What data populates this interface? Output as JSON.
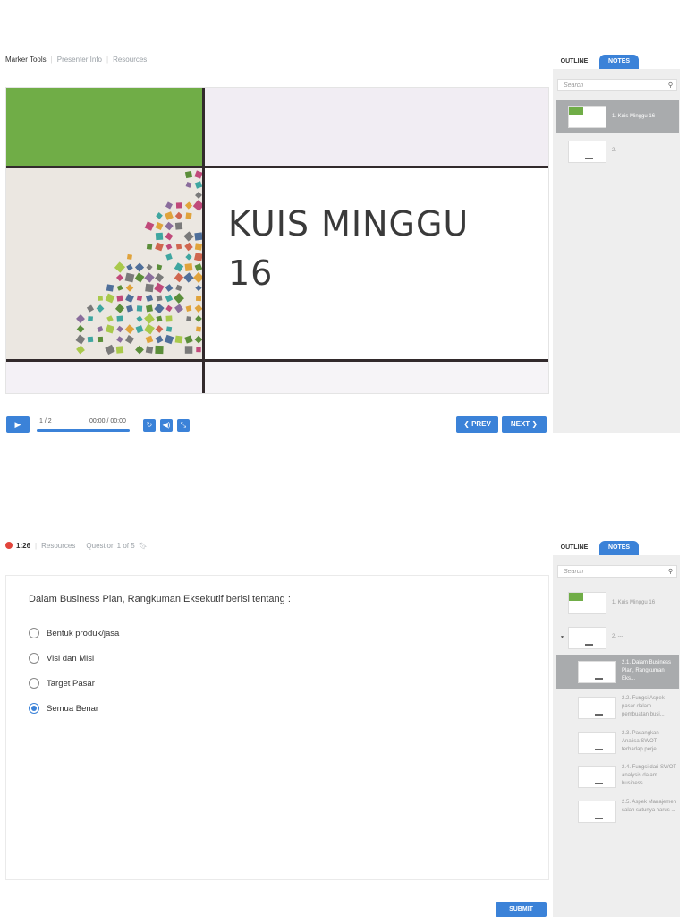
{
  "panel1": {
    "topbar": [
      "Marker Tools",
      "Presenter Info",
      "Resources"
    ],
    "slide_title_line1": "KUIS MINGGU",
    "slide_title_line2": "16",
    "controls": {
      "play_icon": "play-icon",
      "slide_counter": "1 / 2",
      "time": "00:00 / 00:00",
      "progress": 1.0,
      "icons": [
        "replay-icon",
        "volume-icon",
        "fullscreen-icon"
      ],
      "prev_label": "❮ PREV",
      "next_label": "NEXT ❯"
    },
    "sidebar": {
      "tabs": [
        "OUTLINE",
        "NOTES"
      ],
      "search_placeholder": "Search",
      "items": [
        {
          "label": "1. Kuis Minggu 16",
          "selected": true
        },
        {
          "label": "2. ---",
          "selected": false
        }
      ]
    }
  },
  "panel2": {
    "topbar": {
      "timer": "1:26",
      "resources": "Resources",
      "question_count": "Question 1 of 5"
    },
    "question": "Dalam Business Plan, Rangkuman Eksekutif berisi tentang :",
    "options": [
      {
        "label": "Bentuk produk/jasa",
        "selected": false
      },
      {
        "label": "Visi dan Misi",
        "selected": false
      },
      {
        "label": "Target Pasar",
        "selected": false
      },
      {
        "label": "Semua Benar",
        "selected": true
      }
    ],
    "submit_label": "SUBMIT",
    "sidebar": {
      "tabs": [
        "OUTLINE",
        "NOTES"
      ],
      "search_placeholder": "Search",
      "items": [
        {
          "label": "1. Kuis Minggu 16"
        },
        {
          "label": "2. ---"
        },
        {
          "label": "2.1. Dalam Business Plan, Rangkuman Eks..."
        },
        {
          "label": "2.2. Fungsi Aspek pasar dalam pembuatan busi..."
        },
        {
          "label": "2.3. Pasangkan Analisa SWOT terhadap perjel..."
        },
        {
          "label": "2.4. Fungsi dari SWOT analysis dalam business ..."
        },
        {
          "label": "2.5. Aspek Manajemen salah satunya harus ..."
        }
      ]
    }
  },
  "colors": {
    "accent": "#3b82d8",
    "slide_green": "#70ad47",
    "slide_dark": "#322a2c"
  }
}
